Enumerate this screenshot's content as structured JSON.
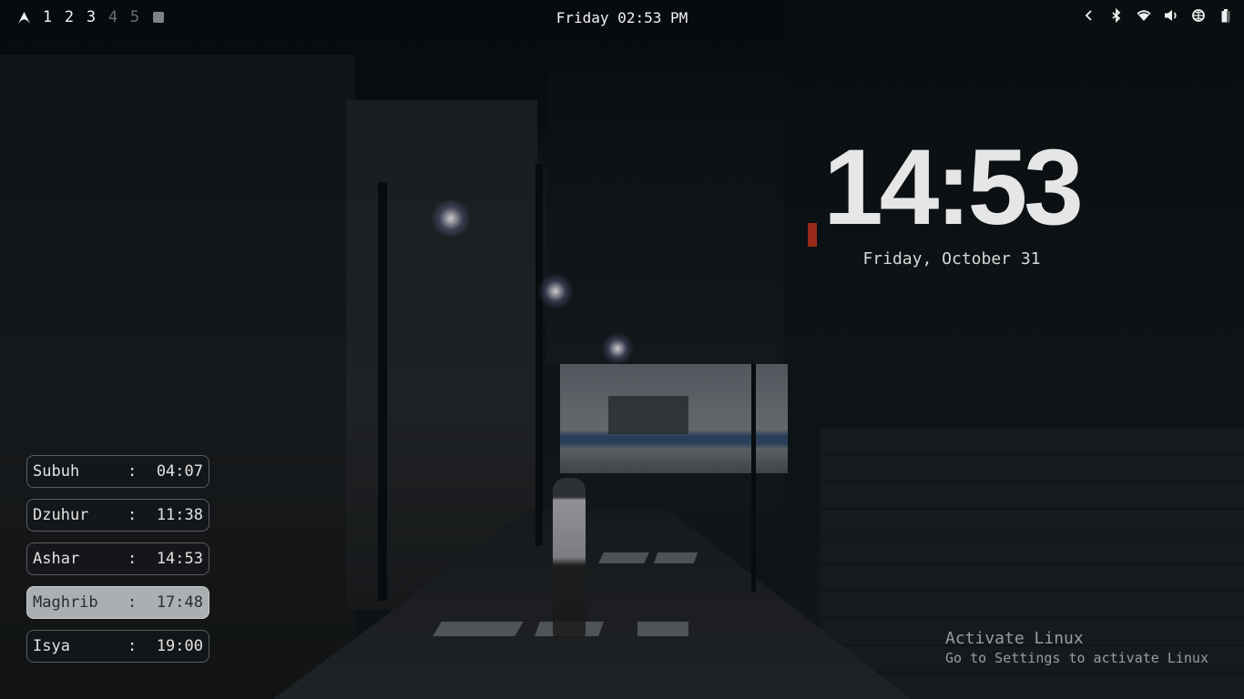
{
  "topbar": {
    "workspaces": [
      {
        "label": "1",
        "state": "active"
      },
      {
        "label": "2",
        "state": "active"
      },
      {
        "label": "3",
        "state": "active"
      },
      {
        "label": "4",
        "state": "inactive"
      },
      {
        "label": "5",
        "state": "inactive"
      }
    ],
    "clock": "Friday 02:53 PM",
    "tray_icons": [
      "chevron-left-icon",
      "bluetooth-icon",
      "wifi-icon",
      "volume-icon",
      "network-globe-icon",
      "battery-icon"
    ]
  },
  "clock_widget": {
    "time": "14:53",
    "date": "Friday, October 31"
  },
  "prayer_times": [
    {
      "name": "Subuh",
      "separator": ":",
      "time": "04:07",
      "highlighted": false
    },
    {
      "name": "Dzuhur",
      "separator": ":",
      "time": "11:38",
      "highlighted": false
    },
    {
      "name": "Ashar",
      "separator": ":",
      "time": "14:53",
      "highlighted": false
    },
    {
      "name": "Maghrib",
      "separator": ":",
      "time": "17:48",
      "highlighted": true
    },
    {
      "name": "Isya",
      "separator": ":",
      "time": "19:00",
      "highlighted": false
    }
  ],
  "watermark": {
    "title": "Activate Linux",
    "subtitle": "Go to Settings to activate Linux"
  },
  "colors": {
    "text": "#f2f2f2",
    "inactive_workspace": "#6b6f73",
    "highlight_row": "#c8cacc"
  }
}
